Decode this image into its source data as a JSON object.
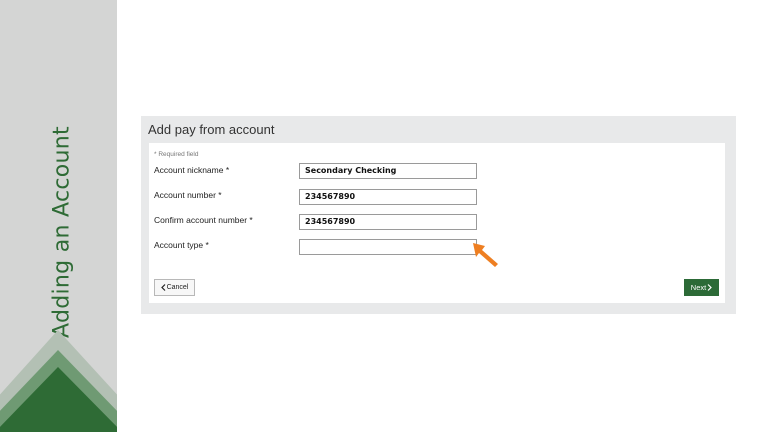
{
  "sidebar": {
    "title": "Adding an Account"
  },
  "panel": {
    "title": "Add pay from account",
    "required_note": "* Required field",
    "fields": [
      {
        "label": "Account nickname *",
        "value": "Secondary Checking"
      },
      {
        "label": "Account number *",
        "value": "234567890"
      },
      {
        "label": "Confirm account number *",
        "value": "234567890"
      },
      {
        "label": "Account type *",
        "value": ""
      }
    ],
    "cancel_label": "Cancel",
    "next_label": "Next"
  },
  "icons": {
    "cancel": "chevron-left-icon",
    "next": "chevron-right-icon",
    "cursor": "pointer-cursor-icon"
  },
  "colors": {
    "brand_green": "#2c6a37",
    "cursor_orange": "#ee7f22",
    "sidebar_gray": "#d4d5d4"
  }
}
